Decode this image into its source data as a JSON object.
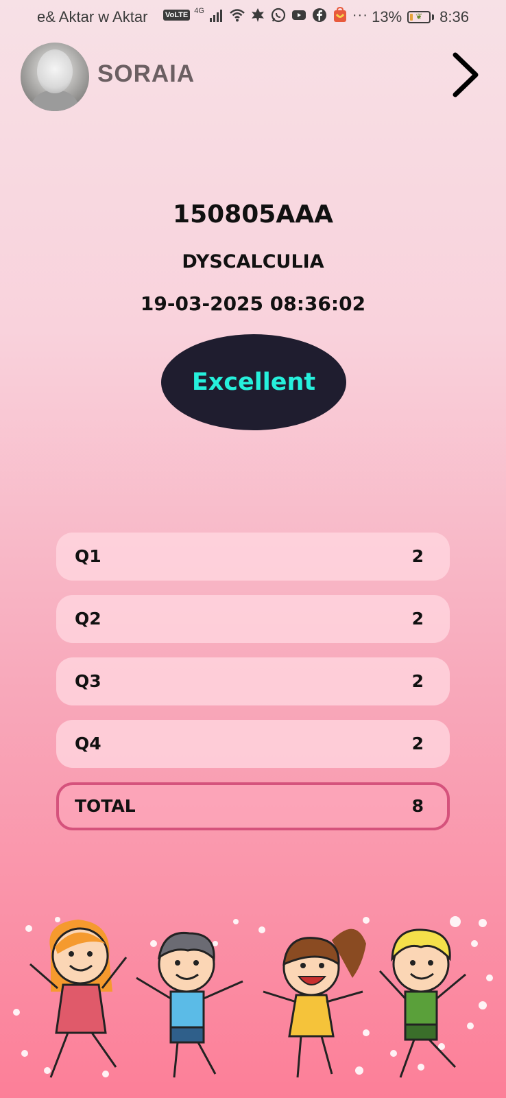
{
  "status_bar": {
    "carrier": "e& Aktar w Aktar",
    "volte": "VoLTE",
    "network": "4G",
    "more": "···",
    "battery_percent": "13%",
    "battery_level": 0.13,
    "time": "8:36"
  },
  "header": {
    "username": "SORAIA"
  },
  "result": {
    "code": "150805AAA",
    "category": "DYSCALCULIA",
    "datetime": "19-03-2025 08:36:02",
    "rating": "Excellent"
  },
  "scores": [
    {
      "label": "Q1",
      "value": "2"
    },
    {
      "label": "Q2",
      "value": "2"
    },
    {
      "label": "Q3",
      "value": "2"
    },
    {
      "label": "Q4",
      "value": "2"
    }
  ],
  "total": {
    "label": "TOTAL",
    "value": "8"
  },
  "colors": {
    "badge_bg": "#1f1d2f",
    "badge_text": "#26f0dc",
    "total_border": "#d5527c"
  }
}
